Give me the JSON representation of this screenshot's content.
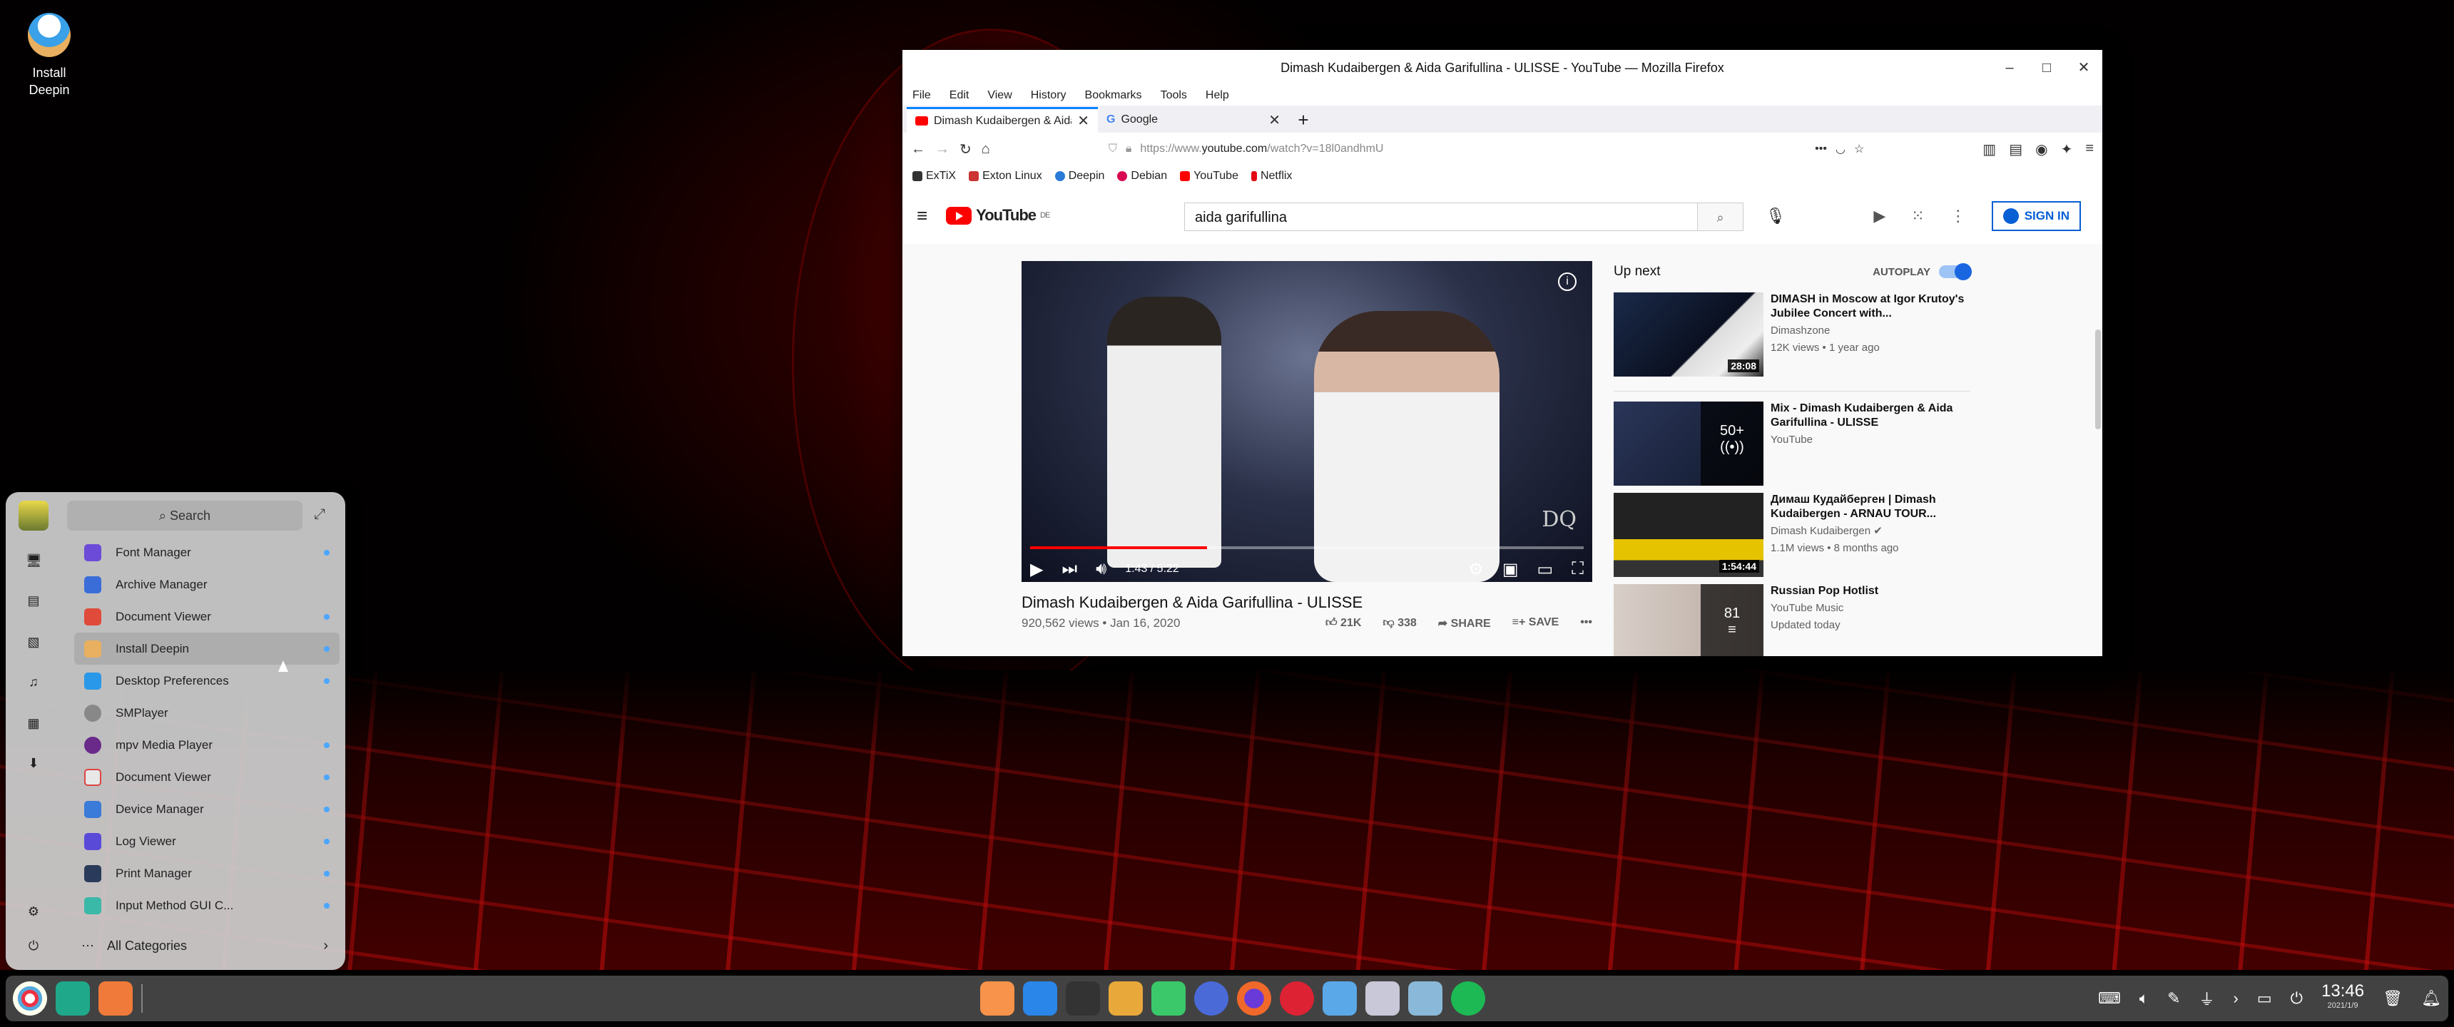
{
  "desktop": {
    "icon_label_1": "Install",
    "icon_label_2": "Deepin"
  },
  "browser": {
    "title": "Dimash Kudaibergen & Aida Garifullina - ULISSE - YouTube — Mozilla Firefox",
    "menu": [
      "File",
      "Edit",
      "View",
      "History",
      "Bookmarks",
      "Tools",
      "Help"
    ],
    "tabs": [
      {
        "label": "Dimash Kudaibergen & Aida"
      },
      {
        "label": "Google"
      }
    ],
    "url_prefix": "https://www.",
    "url_host": "youtube.com",
    "url_path": "/watch?v=18l0andhmU",
    "bookmarks": [
      "ExTiX",
      "Exton Linux",
      "Deepin",
      "Debian",
      "YouTube",
      "Netflix"
    ]
  },
  "youtube": {
    "logo": "YouTube",
    "logo_region": "DE",
    "search_value": "aida garifullina",
    "sign_in": "SIGN IN",
    "video_time": "1:43 / 5:22",
    "progress": 0.32,
    "video_title": "Dimash Kudaibergen & Aida Garifullina - ULISSE",
    "views": "920,562 views",
    "date": "Jan 16, 2020",
    "likes": "21K",
    "dislikes": "338",
    "share": "SHARE",
    "save": "SAVE",
    "up_next": "Up next",
    "autoplay": "AUTOPLAY",
    "items": [
      {
        "title": "DIMASH in Moscow at Igor Krutoy's Jubilee Concert with...",
        "channel": "Dimashzone",
        "meta": "12K views • 1 year ago",
        "duration": "28:08"
      },
      {
        "title": "Mix - Dimash Kudaibergen & Aida Garifullina - ULISSE",
        "channel": "YouTube",
        "meta": "",
        "duration": "50+"
      },
      {
        "title": "Димаш Кудайберген | Dimash Kudaibergen - ARNAU TOUR...",
        "channel": "Dimash Kudaibergen",
        "meta": "1.1M views • 8 months ago",
        "duration": "1:54:44"
      },
      {
        "title": "Russian Pop Hotlist",
        "channel": "YouTube Music",
        "meta": "Updated today",
        "duration": "81"
      }
    ]
  },
  "launcher": {
    "search_placeholder": "Search",
    "apps": [
      "Font Manager",
      "Archive Manager",
      "Document Viewer",
      "Install Deepin",
      "Desktop Preferences",
      "SMPlayer",
      "mpv Media Player",
      "Document Viewer",
      "Device Manager",
      "Log Viewer",
      "Print Manager",
      "Input Method GUI C..."
    ],
    "all_categories": "All Categories"
  },
  "dock": {
    "time": "13:46",
    "date": "2021/1/9"
  }
}
